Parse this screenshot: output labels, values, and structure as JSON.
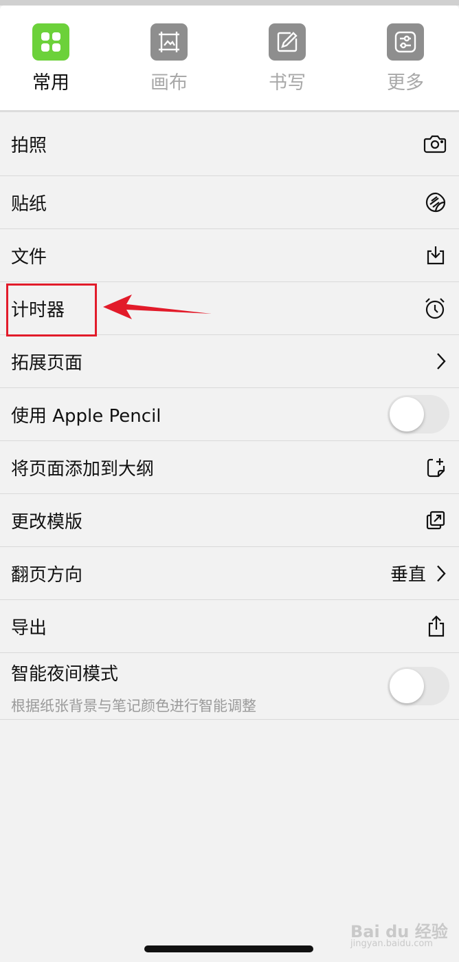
{
  "tabs": [
    {
      "label": "常用",
      "icon": "grid-icon",
      "active": true,
      "color": "#6cd13a"
    },
    {
      "label": "画布",
      "icon": "canvas-icon",
      "active": false,
      "color": "#8e8e8e"
    },
    {
      "label": "书写",
      "icon": "pencil-icon",
      "active": false,
      "color": "#8e8e8e"
    },
    {
      "label": "更多",
      "icon": "sliders-icon",
      "active": false,
      "color": "#8e8e8e"
    }
  ],
  "menu": {
    "photo": {
      "label": "拍照",
      "icon": "camera-icon"
    },
    "sticker": {
      "label": "贴纸",
      "icon": "sticker-icon"
    },
    "file": {
      "label": "文件",
      "icon": "download-tray-icon"
    },
    "timer": {
      "label": "计时器",
      "icon": "alarm-clock-icon"
    },
    "extend_page": {
      "label": "拓展页面",
      "icon": "chevron-right-icon"
    },
    "apple_pencil": {
      "label": "使用 Apple Pencil",
      "toggle": false
    },
    "add_to_outline": {
      "label": "将页面添加到大纲",
      "icon": "add-note-icon"
    },
    "change_template": {
      "label": "更改模版",
      "icon": "swap-template-icon"
    },
    "page_direction": {
      "label": "翻页方向",
      "value": "垂直",
      "icon": "chevron-right-icon"
    },
    "export": {
      "label": "导出",
      "icon": "share-icon"
    },
    "night_mode": {
      "label": "智能夜间模式",
      "description": "根据纸张背景与笔记颜色进行智能调整",
      "toggle": false
    }
  },
  "annotation": {
    "color": "#e21b2a"
  },
  "watermark": {
    "line1": "Bai du 经验",
    "line2": "jingyan.baidu.com"
  }
}
